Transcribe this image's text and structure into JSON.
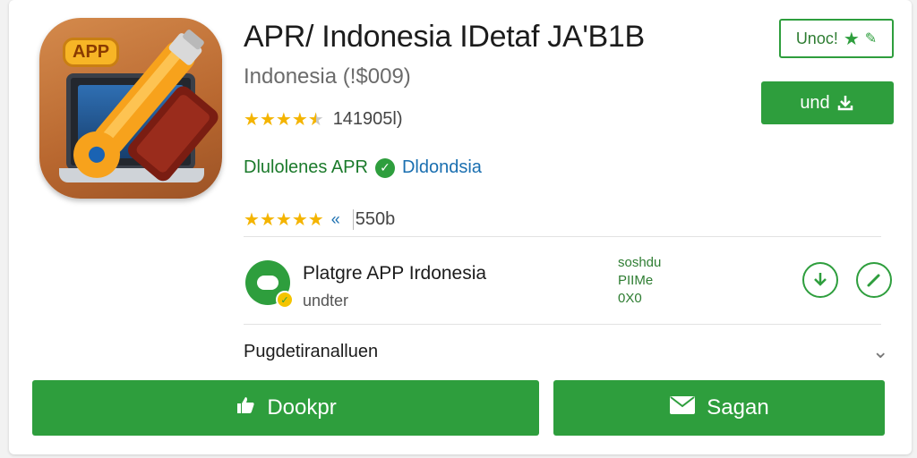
{
  "app": {
    "icon_badge": "APP",
    "title": "APR/ Indonesia IDetaf JA'B1B",
    "subtitle": "Indonesia (!$009)",
    "rating_text": "141905l)",
    "developer_name": "Dlulolenes APR",
    "developer_region": "Dldondsia",
    "size_text": "550b"
  },
  "actions": {
    "wishlist_label": "Unoc!",
    "install_label": "und"
  },
  "listing": {
    "title": "Platgre APP Irdonesia",
    "subtitle": "undter",
    "meta_lines": [
      "soshdu",
      "PIIMe",
      "0X0"
    ]
  },
  "expand": {
    "label": "Pugdetiranalluen"
  },
  "footer": {
    "left_label": "Dookpr",
    "right_label": "Sagan"
  },
  "colors": {
    "accent": "#2e9e3d",
    "star": "#f4b400",
    "link": "#1a6fb0"
  },
  "icons": [
    "wrench-icon",
    "star-icon",
    "pencil-icon",
    "download-icon",
    "verified-icon",
    "chevron-down-icon",
    "thumbs-up-icon",
    "mail-icon"
  ]
}
